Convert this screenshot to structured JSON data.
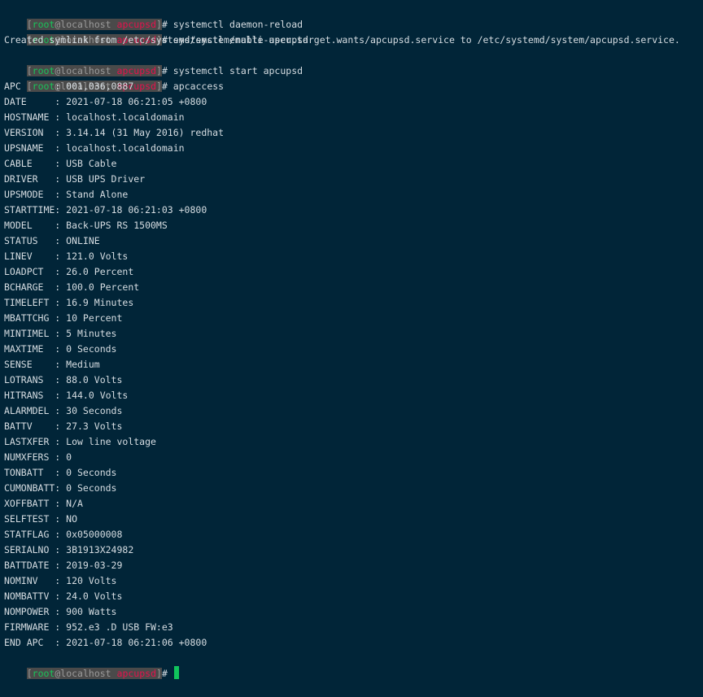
{
  "prompt": {
    "open": "[",
    "user": "root",
    "at": "@",
    "host": "localhost",
    "space": " ",
    "dir": "apcupsd",
    "close": "]",
    "symbol": "# "
  },
  "commands": [
    "systemctl daemon-reload",
    "systemctl enable apcupsd",
    "systemctl start apcupsd",
    "apcaccess"
  ],
  "output_symlink": "Created symlink from /etc/systemd/system/multi-user.target.wants/apcupsd.service to /etc/systemd/system/apcupsd.service.",
  "status_lines": [
    "APC      : 001,036,0887",
    "DATE     : 2021-07-18 06:21:05 +0800",
    "HOSTNAME : localhost.localdomain",
    "VERSION  : 3.14.14 (31 May 2016) redhat",
    "UPSNAME  : localhost.localdomain",
    "CABLE    : USB Cable",
    "DRIVER   : USB UPS Driver",
    "UPSMODE  : Stand Alone",
    "STARTTIME: 2021-07-18 06:21:03 +0800",
    "MODEL    : Back-UPS RS 1500MS",
    "STATUS   : ONLINE",
    "LINEV    : 121.0 Volts",
    "LOADPCT  : 26.0 Percent",
    "BCHARGE  : 100.0 Percent",
    "TIMELEFT : 16.9 Minutes",
    "MBATTCHG : 10 Percent",
    "MINTIMEL : 5 Minutes",
    "MAXTIME  : 0 Seconds",
    "SENSE    : Medium",
    "LOTRANS  : 88.0 Volts",
    "HITRANS  : 144.0 Volts",
    "ALARMDEL : 30 Seconds",
    "BATTV    : 27.3 Volts",
    "LASTXFER : Low line voltage",
    "NUMXFERS : 0",
    "TONBATT  : 0 Seconds",
    "CUMONBATT: 0 Seconds",
    "XOFFBATT : N/A",
    "SELFTEST : NO",
    "STATFLAG : 0x05000008",
    "SERIALNO : 3B1913X24982",
    "BATTDATE : 2019-03-29",
    "NOMINV   : 120 Volts",
    "NOMBATTV : 24.0 Volts",
    "NOMPOWER : 900 Watts",
    "FIRMWARE : 952.e3 .D USB FW:e3",
    "END APC  : 2021-07-18 06:21:06 +0800"
  ],
  "colors": {
    "background": "#012538",
    "text": "#d6dde2",
    "prompt_bg": "#4a4a4a",
    "user": "#19c35a",
    "dir": "#e3124d",
    "cursor": "#10c45c"
  }
}
